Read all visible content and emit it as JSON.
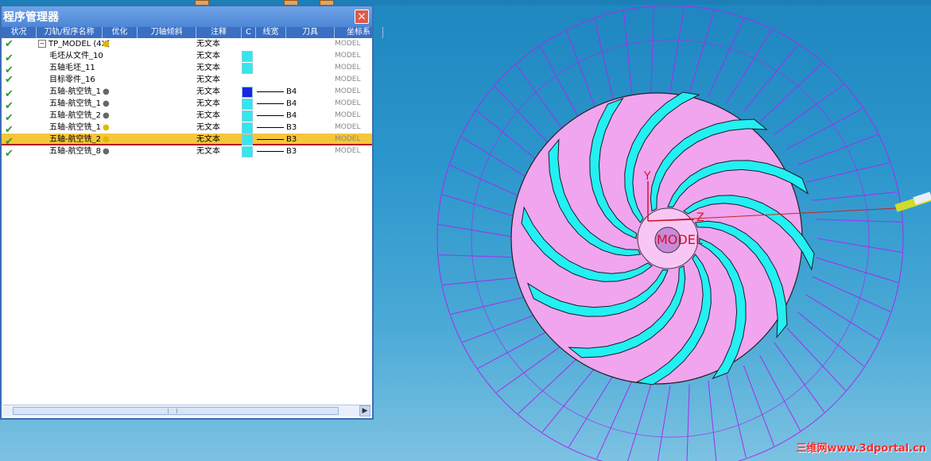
{
  "window": {
    "title": "程序管理器",
    "close_label": "×"
  },
  "columns": [
    "状况",
    "刀轨/程序名称",
    "优化",
    "刀轴倾斜",
    "注释",
    "C",
    "线宽",
    "刀具",
    "坐标系"
  ],
  "rows": [
    {
      "name": "TP_MODEL (4X[",
      "optimize": "",
      "tilt": "",
      "note": "无文本",
      "c_color": "",
      "line": "",
      "tool": "",
      "coord": "MODEL",
      "has_bulb": true,
      "bulb": "yellow",
      "collapsible": true,
      "selected": false
    },
    {
      "name": "毛坯从文件_10",
      "optimize": "",
      "tilt": "",
      "note": "无文本",
      "c_color": "#33e7ee",
      "line": "",
      "tool": "",
      "coord": "MODEL",
      "has_bulb": false,
      "bulb": "",
      "collapsible": false,
      "selected": false
    },
    {
      "name": "五轴毛坯_11",
      "optimize": "",
      "tilt": "",
      "note": "无文本",
      "c_color": "#33e7ee",
      "line": "",
      "tool": "",
      "coord": "MODEL",
      "has_bulb": false,
      "bulb": "",
      "collapsible": false,
      "selected": false
    },
    {
      "name": "目标零件_16",
      "optimize": "",
      "tilt": "",
      "note": "无文本",
      "c_color": "",
      "line": "",
      "tool": "",
      "coord": "MODEL",
      "has_bulb": false,
      "bulb": "",
      "collapsible": false,
      "selected": false
    },
    {
      "name": "五轴-航空铣_1",
      "optimize": "",
      "tilt": "",
      "note": "无文本",
      "c_color": "#1a24e6",
      "line": "1",
      "tool": "B4",
      "coord": "MODEL",
      "has_bulb": true,
      "bulb": "gray",
      "collapsible": false,
      "selected": false
    },
    {
      "name": "五轴-航空铣_1",
      "optimize": "",
      "tilt": "",
      "note": "无文本",
      "c_color": "#33e7ee",
      "line": "1",
      "tool": "B4",
      "coord": "MODEL",
      "has_bulb": true,
      "bulb": "gray",
      "collapsible": false,
      "selected": false
    },
    {
      "name": "五轴-航空铣_2",
      "optimize": "",
      "tilt": "",
      "note": "无文本",
      "c_color": "#33e7ee",
      "line": "1",
      "tool": "B4",
      "coord": "MODEL",
      "has_bulb": true,
      "bulb": "gray",
      "collapsible": false,
      "selected": false
    },
    {
      "name": "五轴-航空铣_1",
      "optimize": "",
      "tilt": "",
      "note": "无文本",
      "c_color": "#33e7ee",
      "line": "1",
      "tool": "B3",
      "coord": "MODEL",
      "has_bulb": true,
      "bulb": "yellow",
      "collapsible": false,
      "selected": false
    },
    {
      "name": "五轴-航空铣_2",
      "optimize": "",
      "tilt": "",
      "note": "无文本",
      "c_color": "#33e7ee",
      "line": "1",
      "tool": "B3",
      "coord": "MODEL",
      "has_bulb": true,
      "bulb": "yellow",
      "collapsible": false,
      "selected": true
    },
    {
      "name": "五轴-航空铣_8",
      "optimize": "",
      "tilt": "",
      "note": "无文本",
      "c_color": "#33e7ee",
      "line": "1",
      "tool": "B3",
      "coord": "MODEL",
      "has_bulb": true,
      "bulb": "gray",
      "collapsible": false,
      "selected": false
    }
  ],
  "viewport": {
    "axis_y": "Y",
    "axis_z": "Z",
    "model_label": "MODEL"
  },
  "watermark": "三维网www.3dportal.cn",
  "colors": {
    "impeller_body": "#f0a5ee",
    "blade_cyan": "#22f0f2",
    "toolpath": "#a52cf0",
    "selection": "#f6c63a"
  }
}
